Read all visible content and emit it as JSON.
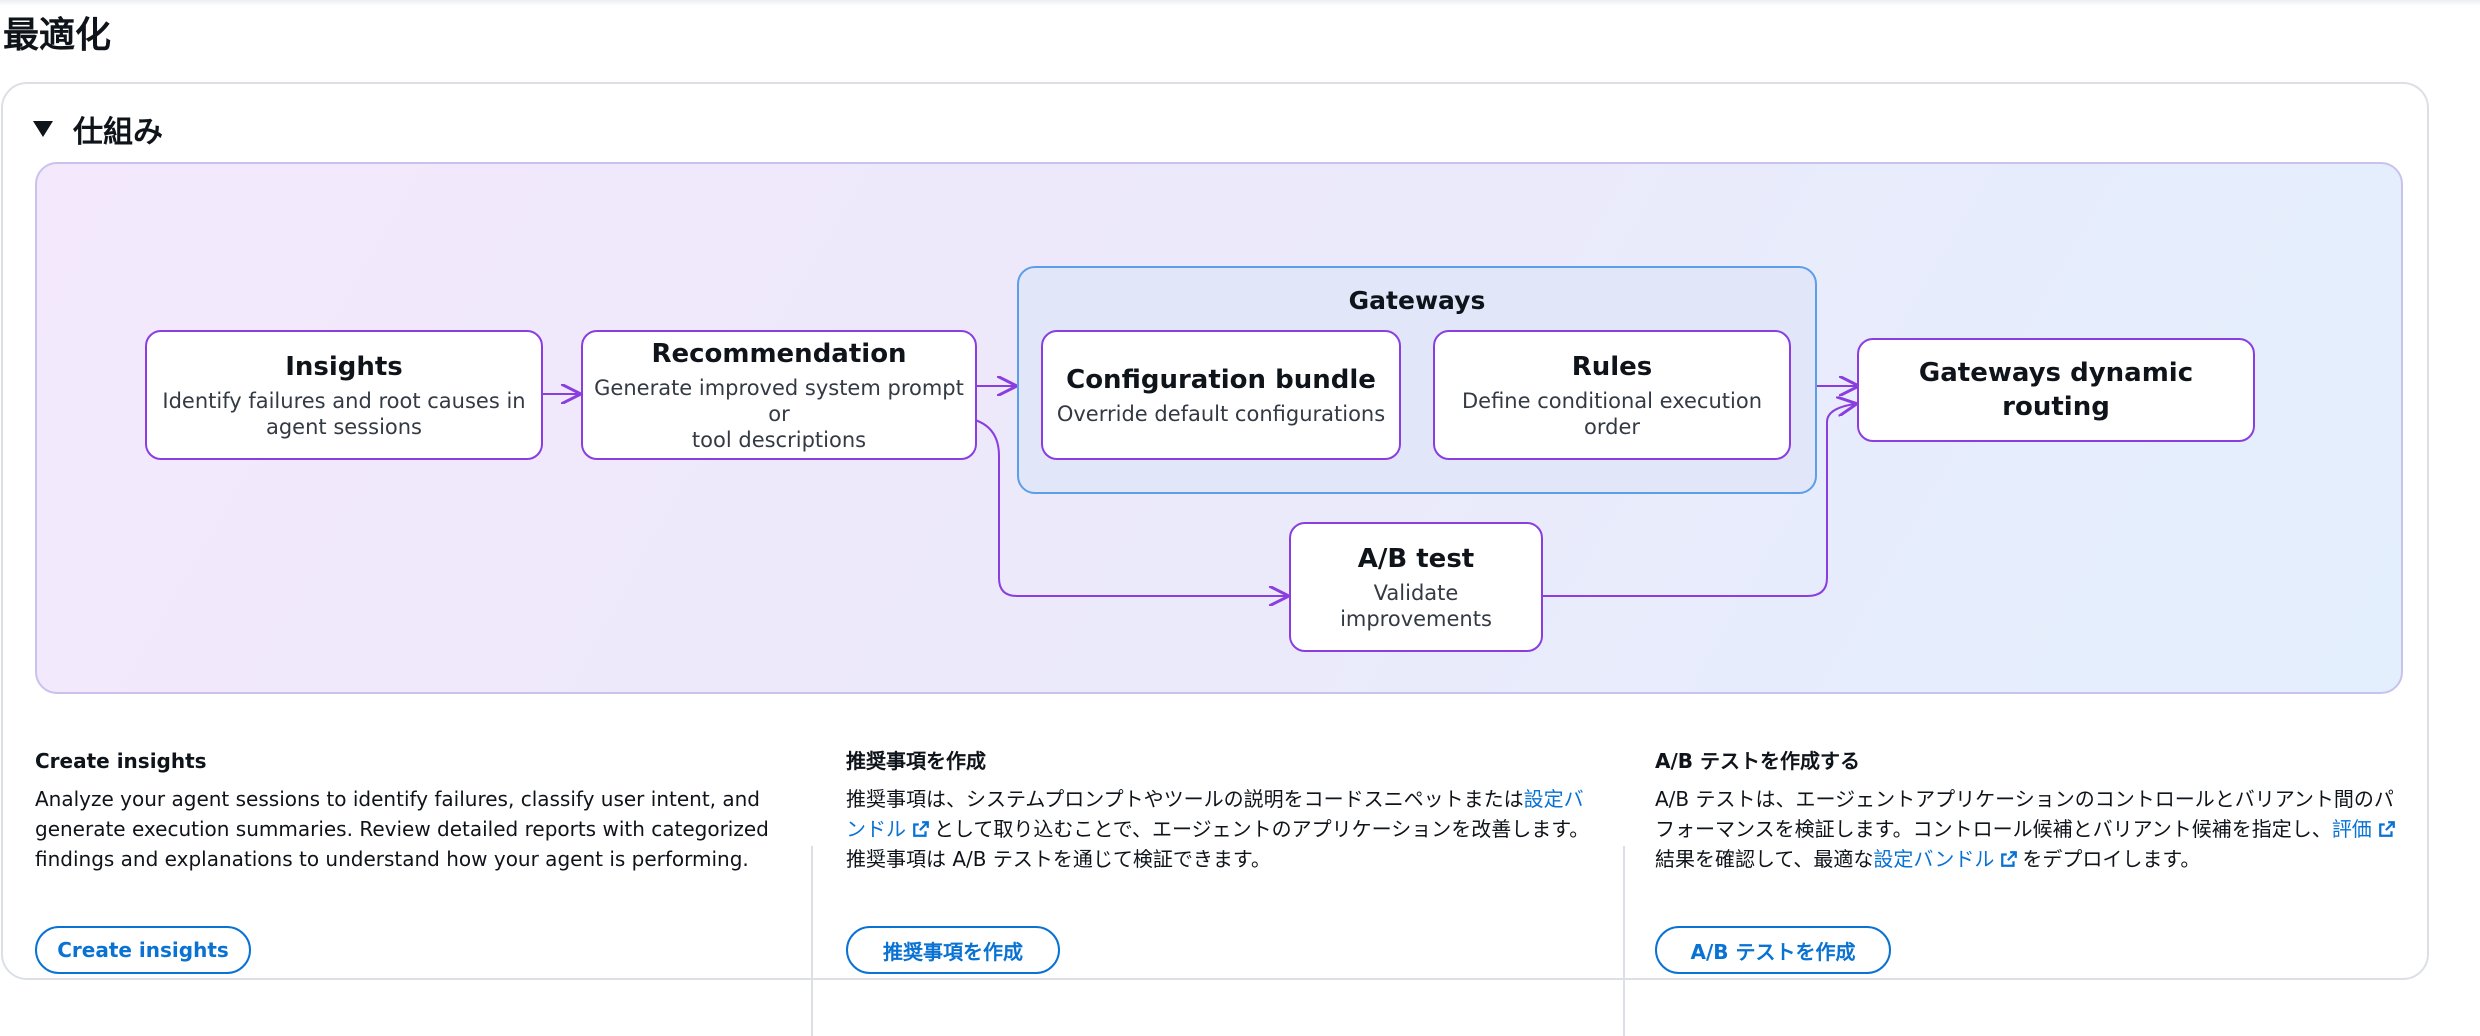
{
  "page": {
    "title": "最適化"
  },
  "section": {
    "title": "仕組み"
  },
  "diagram": {
    "insights": {
      "title": "Insights",
      "desc1": "Identify failures and root causes in",
      "desc2": "agent sessions"
    },
    "recommendation": {
      "title": "Recommendation",
      "desc1": "Generate improved system prompt or",
      "desc2": "tool descriptions"
    },
    "gateways_group": {
      "title": "Gateways"
    },
    "config_bundle": {
      "title": "Configuration bundle",
      "desc": "Override default configurations"
    },
    "rules": {
      "title": "Rules",
      "desc": "Define conditional execution order"
    },
    "dynamic_routing": {
      "title": "Gateways dynamic routing"
    },
    "ab_test": {
      "title": "A/B test",
      "desc": "Validate improvements"
    }
  },
  "columns": [
    {
      "title": "Create insights",
      "body": "Analyze your agent sessions to identify failures, classify user intent, and generate execution summaries. Review detailed reports with categorized findings and explanations to understand how your agent is performing.",
      "button": "Create insights"
    },
    {
      "title": "推奨事項を作成",
      "body_pre": "推奨事項は、システムプロンプトやツールの説明をコードスニペットまたは",
      "link1": "設定バンドル",
      "body_post": "として取り込むことで、エージェントのアプリケーションを改善します。推奨事項は A/B テストを通じて検証できます。",
      "button": "推奨事項を作成"
    },
    {
      "title": "A/B テストを作成する",
      "body_pre": "A/B テストは、エージェントアプリケーションのコントロールとバリアント間のパフォーマンスを検証します。コントロール候補とバリアント候補を指定し、",
      "link1": "評価",
      "body_mid": "結果を確認して、最適な",
      "link2": "設定バンドル",
      "body_post": "をデプロイします。",
      "button": "A/B テストを作成"
    }
  ],
  "colors": {
    "accent": "#0972d3",
    "node_border": "#8b3ee0",
    "group_border": "#5c9ee8"
  }
}
